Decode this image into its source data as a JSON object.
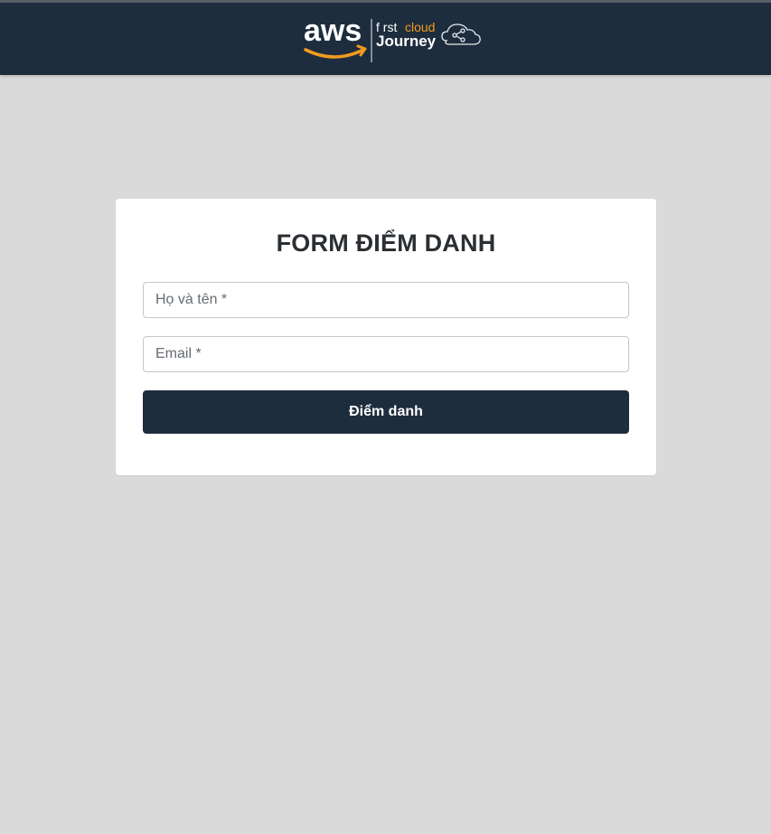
{
  "header": {
    "logo": {
      "aws_text": "aws",
      "first_text": "f rst",
      "cloud_text": "cloud",
      "journey_text": "Journey",
      "icon": "cloud-share-icon"
    }
  },
  "form": {
    "title": "FORM ĐIỂM DANH",
    "name_placeholder": "Họ và tên *",
    "email_placeholder": "Email *",
    "submit_label": "Điểm danh"
  },
  "colors": {
    "header_bg": "#1e2d3e",
    "page_bg": "#dadada",
    "accent_orange": "#f29a1f"
  }
}
